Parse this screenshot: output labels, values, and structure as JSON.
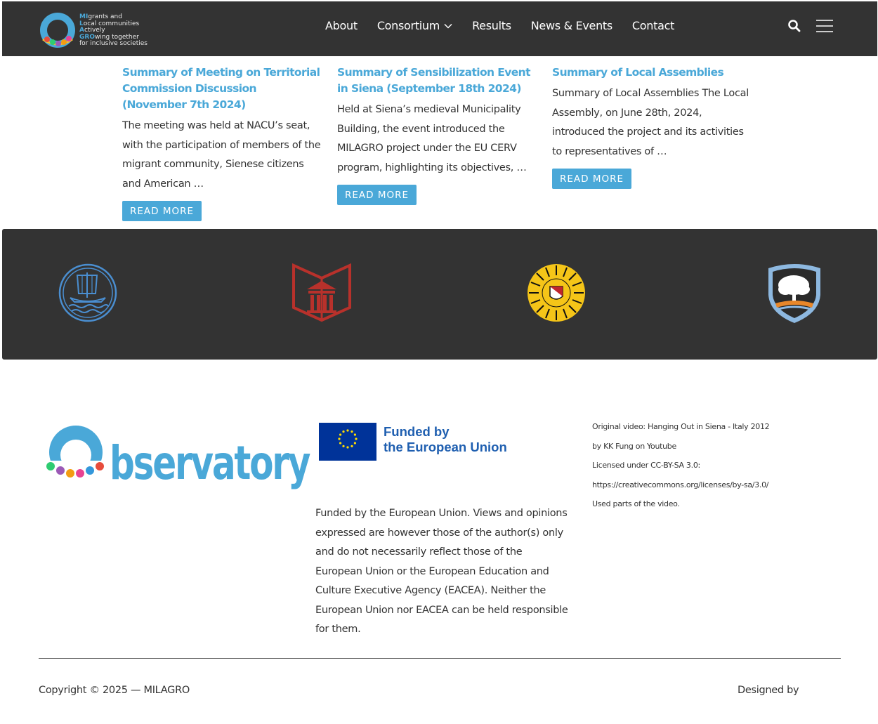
{
  "header": {
    "logo_alt": "MILAGRO",
    "logo_lines": [
      {
        "hl": "MI",
        "rest": "grants and"
      },
      {
        "hl": "L",
        "rest": "ocal communities"
      },
      {
        "hl": "A",
        "rest": "ctively"
      },
      {
        "hl": "GRO",
        "rest": "wing together"
      },
      {
        "hl": "",
        "rest": "for inclusive societies"
      }
    ],
    "nav": [
      {
        "label": "About",
        "dropdown": false
      },
      {
        "label": "Consortium",
        "dropdown": true
      },
      {
        "label": "Results",
        "dropdown": false
      },
      {
        "label": "News & Events",
        "dropdown": false
      },
      {
        "label": "Contact",
        "dropdown": false
      }
    ],
    "search_icon": "search-icon",
    "menu_icon": "hamburger-menu-icon"
  },
  "posts": [
    {
      "title": "Summary of Meeting on Territorial Commission Discussion (November 7th 2024)",
      "excerpt": "The meeting was held at NACU’s seat, with the participation of members of the migrant community, Sienese citizens and American …",
      "button": "READ MORE"
    },
    {
      "title": "Summary of Sensibilization Event in Siena (September 18th 2024)",
      "excerpt": "Held at Siena’s medieval Municipality Building, the event introduced the MILAGRO project under the EU CERV program, highlighting its objectives, …",
      "button": "READ MORE"
    },
    {
      "title": "Summary of Local Assemblies",
      "excerpt": "Summary of Local Assemblies The Local Assembly, on June 28th, 2024, introduced the project and its activities to representatives of …",
      "button": "READ MORE"
    }
  ],
  "partners": [
    {
      "name": "ship-emblem-logo"
    },
    {
      "name": "red-building-book-logo"
    },
    {
      "name": "sun-seal-logo"
    },
    {
      "name": "tree-shield-logo"
    }
  ],
  "footer": {
    "observatory_word": "bservatory",
    "observatory_arc": "MILAGRO",
    "eu_funded": "Funded by",
    "eu_union": "the European Union",
    "disclaimer": "Funded by the European Union. Views and opinions expressed are however those of the author(s) only and do not necessarily reflect those of the European Union or the European Education and Culture Executive Agency (EACEA). Neither the European Union nor EACEA can be held responsible for them.",
    "credits": [
      "Original video: Hanging Out in Siena - Italy 2012",
      "by KK Fung on Youtube",
      "Licensed under CC-BY-SA 3.0:",
      "https://creativecommons.org/licenses/by-sa/3.0/",
      "Used parts of the video."
    ],
    "copyright": "Copyright © 2025 — MILAGRO",
    "designed_by": "Designed by"
  },
  "colors": {
    "accent": "#4aa8d8",
    "dark_band": "#333333",
    "eu_blue": "#003399",
    "eu_text": "#1f5fb0"
  }
}
